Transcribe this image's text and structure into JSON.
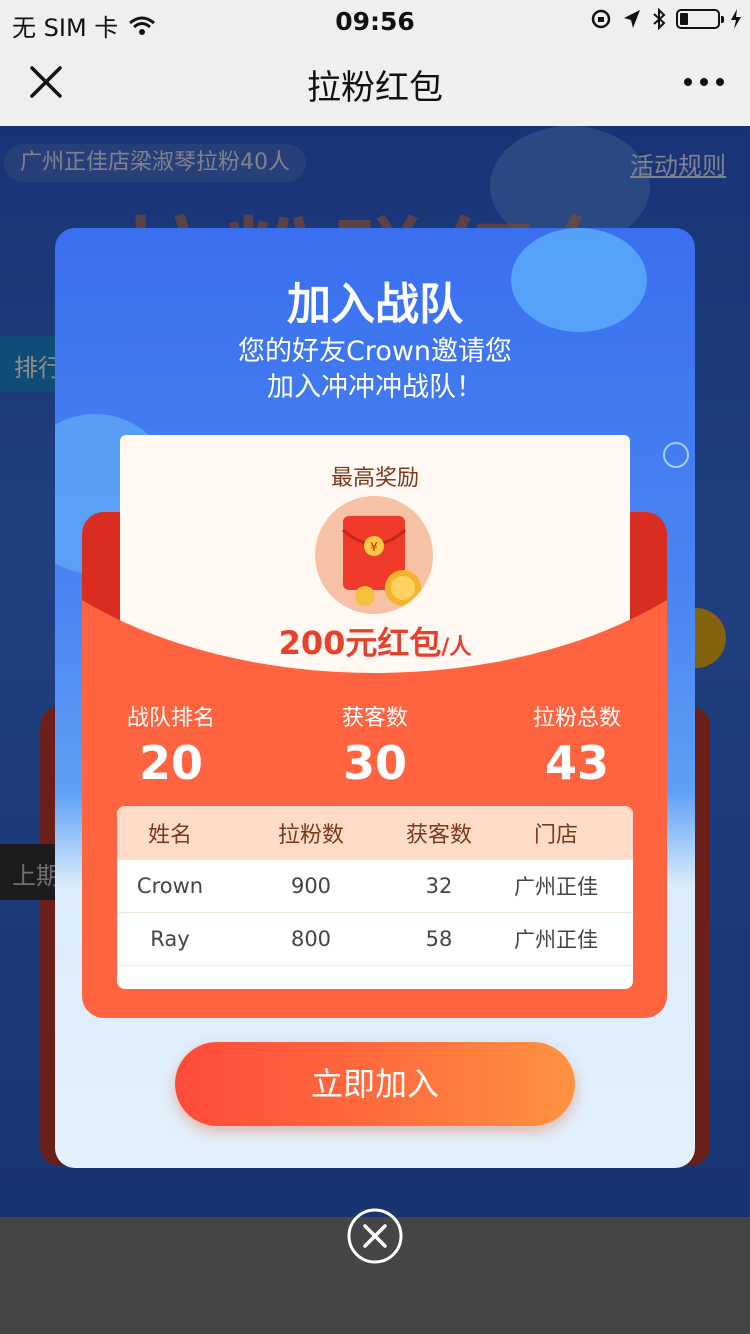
{
  "status_bar": {
    "carrier": "无 SIM 卡",
    "time": "09:56"
  },
  "nav": {
    "title": "拉粉红包"
  },
  "background": {
    "banner": "广州正佳店梁淑琴拉粉40人",
    "rules_link": "活动规则",
    "big_title": "拉粉赚红包",
    "tab_rank": "排行",
    "tab_last": "上期"
  },
  "modal": {
    "title": "加入战队",
    "subtitle_line1": "您的好友Crown邀请您",
    "subtitle_line2": "加入冲冲冲战队！",
    "reward_label": "最高奖励",
    "reward_amount": "200元红包",
    "reward_unit": "/人",
    "stats": [
      {
        "label": "战队排名",
        "value": "20"
      },
      {
        "label": "获客数",
        "value": "30"
      },
      {
        "label": "拉粉总数",
        "value": "43"
      }
    ],
    "table": {
      "headers": [
        "姓名",
        "拉粉数",
        "获客数",
        "门店"
      ],
      "rows": [
        [
          "Crown",
          "900",
          "32",
          "广州正佳"
        ],
        [
          "Ray",
          "800",
          "58",
          "广州正佳"
        ]
      ]
    },
    "join_button": "立即加入"
  },
  "colors": {
    "primary_blue": "#3a6fef",
    "envelope_red": "#ff5b3a",
    "button_gradient_start": "#ff4a3a",
    "button_gradient_end": "#ff9340",
    "amount_red": "#e8412b"
  }
}
